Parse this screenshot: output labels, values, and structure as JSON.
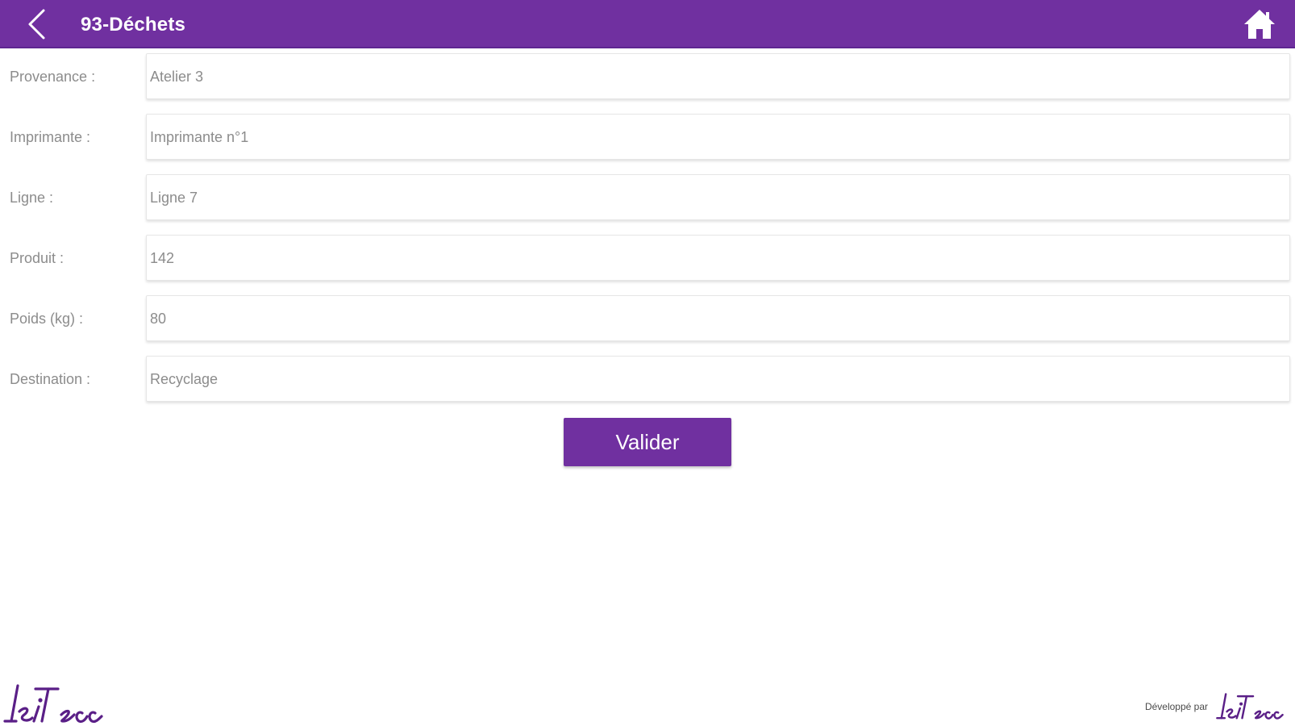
{
  "header": {
    "title": "93-Déchets",
    "back_icon": "chevron-left-icon",
    "home_icon": "home-icon",
    "color": "#7030a0"
  },
  "form": {
    "fields": [
      {
        "label": "Provenance :",
        "value": "Atelier 3"
      },
      {
        "label": "Imprimante :",
        "value": "Imprimante n°1"
      },
      {
        "label": "Ligne :",
        "value": "Ligne 7"
      },
      {
        "label": "Produit :",
        "value": "142"
      },
      {
        "label": "Poids (kg) :",
        "value": "80"
      },
      {
        "label": "Destination :",
        "value": "Recyclage"
      }
    ],
    "submit_label": "Valider"
  },
  "footer": {
    "developed_by": "Développé par",
    "brand_logo": "isitecc"
  }
}
